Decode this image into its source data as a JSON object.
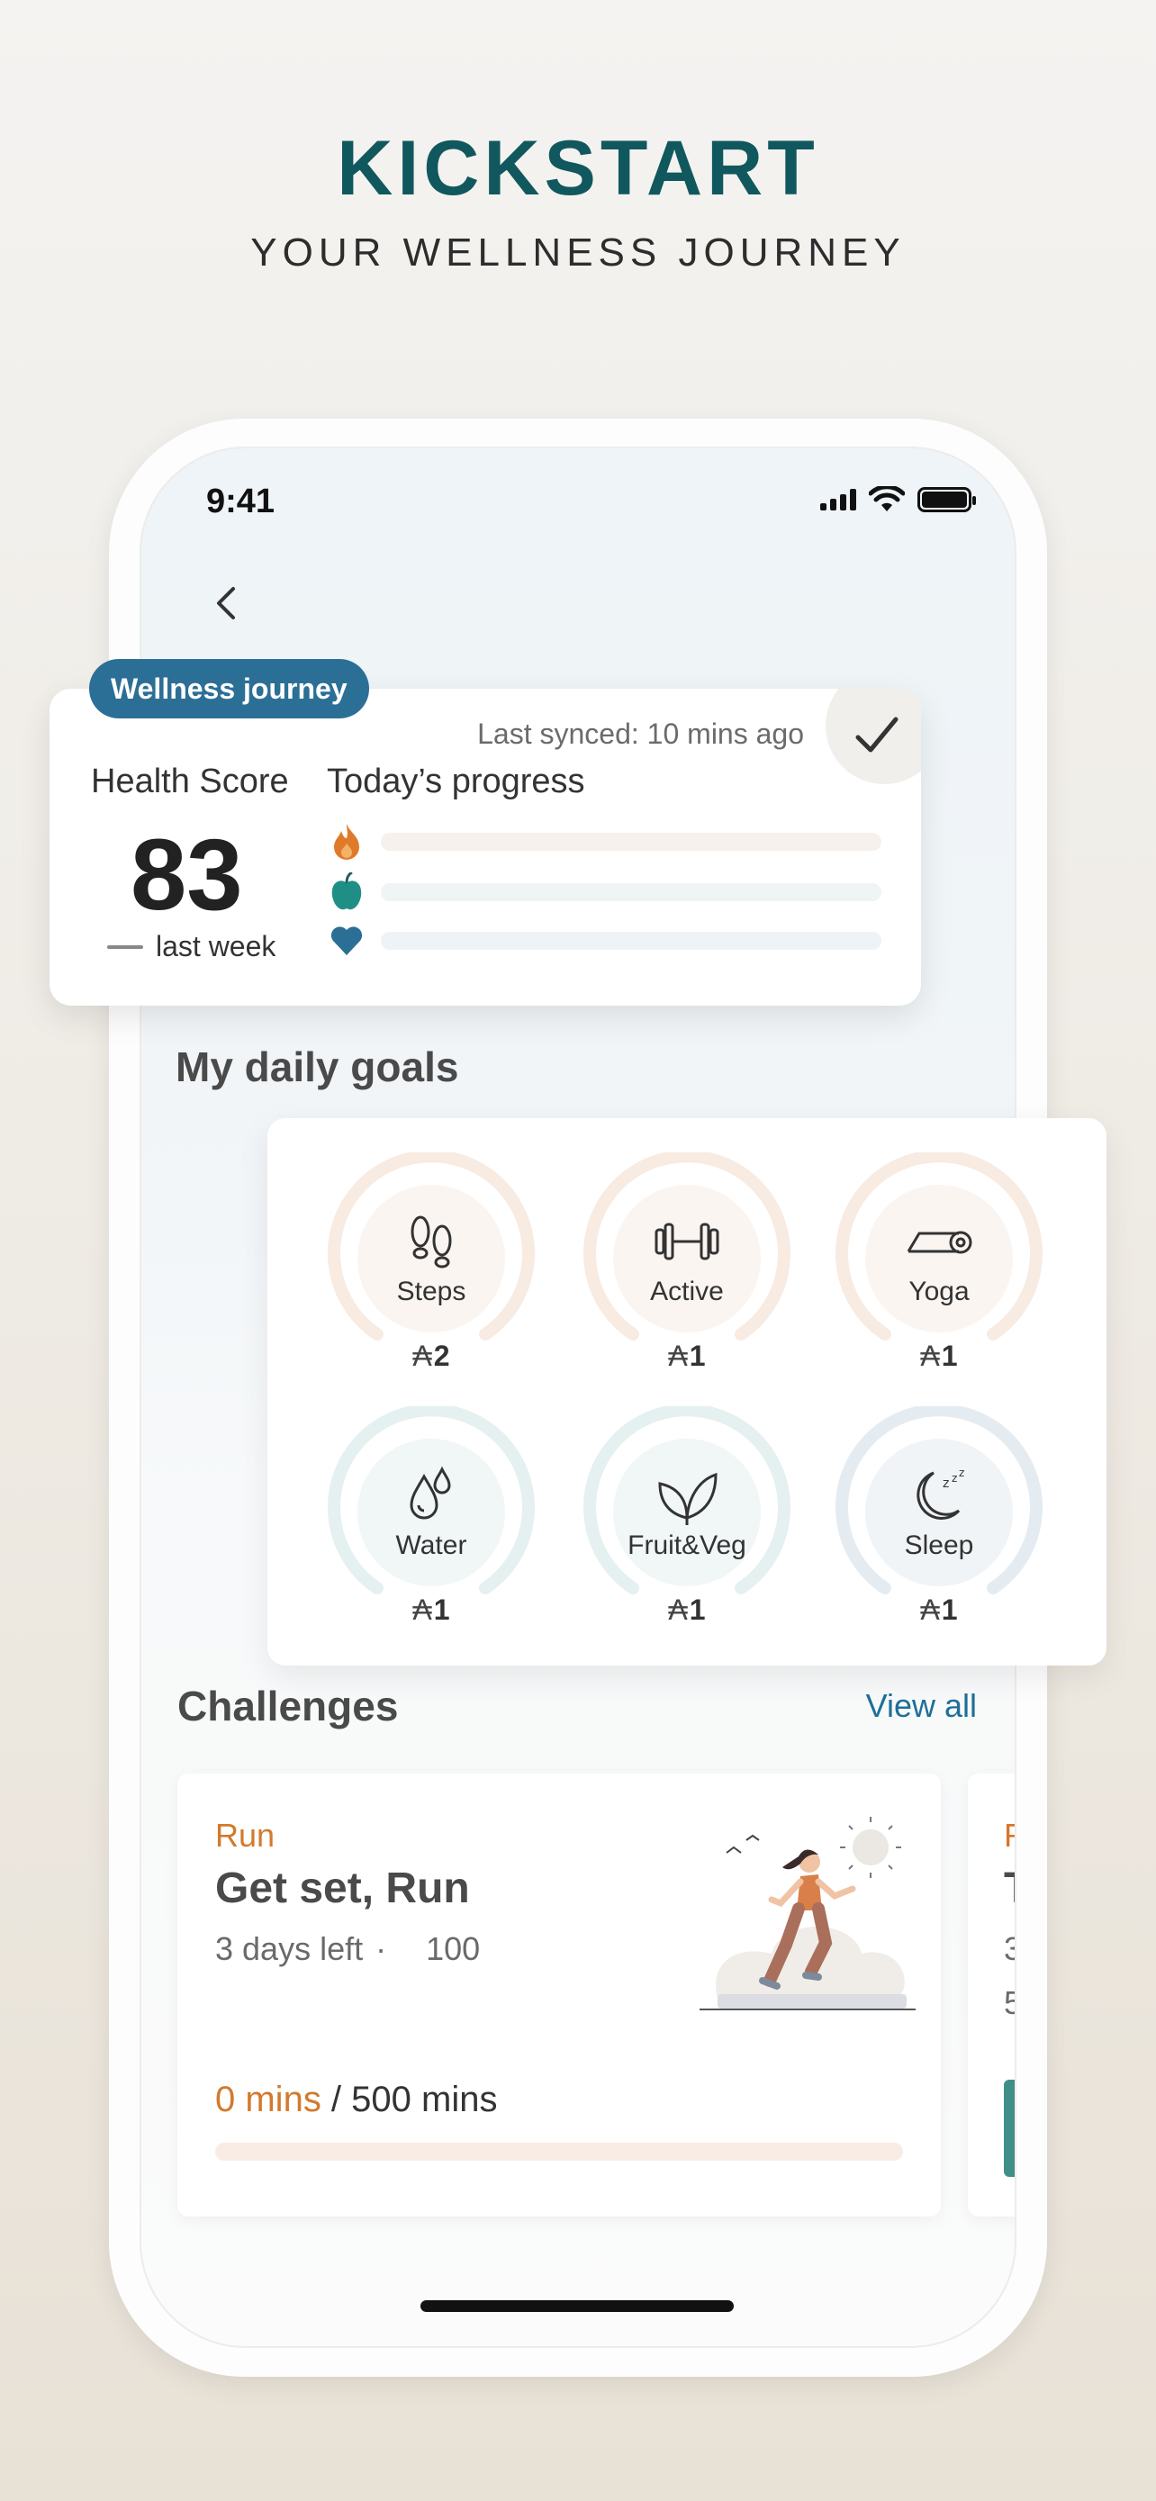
{
  "hero": {
    "title": "KICKSTART",
    "subtitle": "YOUR WELLNESS JOURNEY"
  },
  "status_bar": {
    "time": "9:41"
  },
  "health_card": {
    "badge": "Wellness journey",
    "last_synced": "Last synced: 10 mins ago",
    "health_score_label": "Health Score",
    "health_score_value": "83",
    "trend_text": "last week",
    "todays_progress_label": "Today’s progress",
    "progress_rows": [
      {
        "icon": "flame-icon",
        "color": "#e07a2b",
        "value": 0
      },
      {
        "icon": "apple-icon",
        "color": "#1f8f86",
        "value": 0
      },
      {
        "icon": "heart-icon",
        "color": "#2c6f96",
        "value": 0
      }
    ]
  },
  "daily_goals": {
    "title": "My daily goals",
    "items": [
      {
        "label": "Steps",
        "icon": "footsteps-icon",
        "count": "2",
        "symbol": "₳",
        "tone": "warm"
      },
      {
        "label": "Active",
        "icon": "dumbbell-icon",
        "count": "1",
        "symbol": "₳",
        "tone": "warm"
      },
      {
        "label": "Yoga",
        "icon": "yoga-mat-icon",
        "count": "1",
        "symbol": "₳",
        "tone": "warm"
      },
      {
        "label": "Water",
        "icon": "water-drops-icon",
        "count": "1",
        "symbol": "₳",
        "tone": "cool"
      },
      {
        "label": "Fruit&Veg",
        "icon": "leaf-icon",
        "count": "1",
        "symbol": "₳",
        "tone": "cool"
      },
      {
        "label": "Sleep",
        "icon": "moon-zzz-icon",
        "count": "1",
        "symbol": "₳",
        "tone": "blue"
      }
    ]
  },
  "challenges": {
    "title": "Challenges",
    "view_all": "View all",
    "cards": [
      {
        "type": "Run",
        "title": "Get set, Run",
        "days_left": "3 days left",
        "separator": "·",
        "points": "100",
        "progress_done": "0 mins",
        "progress_total": " / 500 mins",
        "progress_fraction": 0
      }
    ],
    "peek_card": {
      "letter_1": "R",
      "letter_2": "T",
      "letter_3": "3",
      "letter_4": "5"
    }
  },
  "colors": {
    "brand_teal": "#10585e",
    "accent_orange": "#d27a2c",
    "link_blue": "#1f6f97",
    "badge_blue": "#2c6f96"
  }
}
